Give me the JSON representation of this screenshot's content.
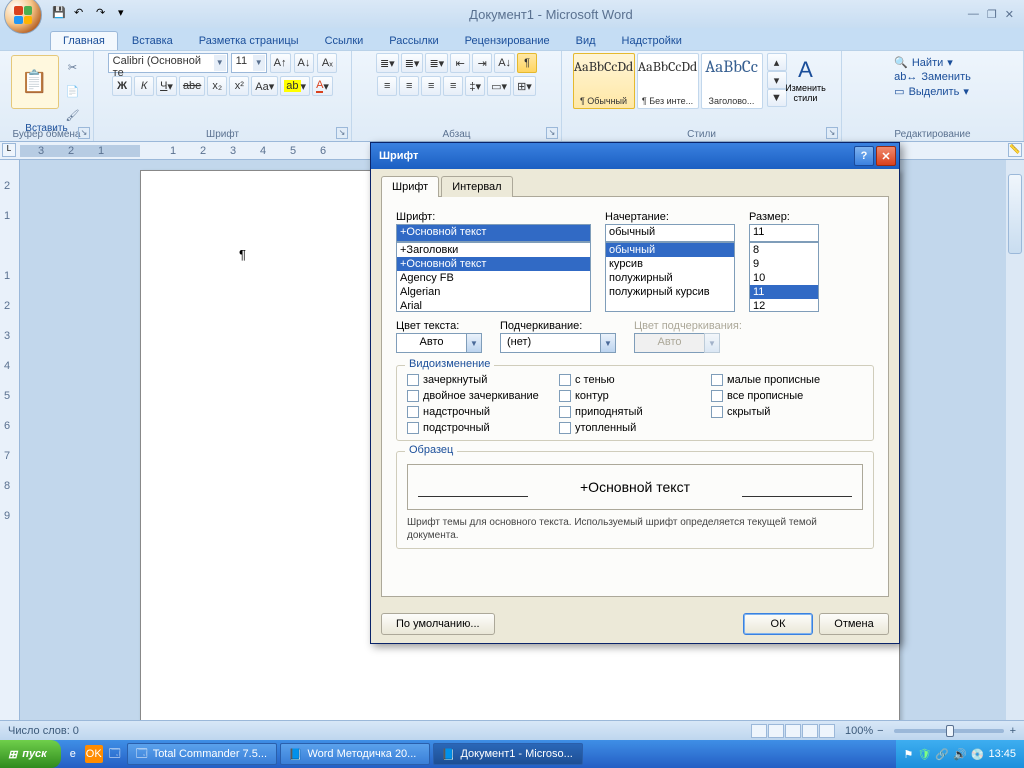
{
  "window": {
    "title": "Документ1 - Microsoft Word"
  },
  "qat": {
    "save": "💾",
    "undo": "↶",
    "redo": "↷"
  },
  "tabs": [
    "Главная",
    "Вставка",
    "Разметка страницы",
    "Ссылки",
    "Рассылки",
    "Рецензирование",
    "Вид",
    "Надстройки"
  ],
  "ribbon": {
    "clipboard": {
      "label": "Буфер обмена",
      "paste": "Вставить"
    },
    "font": {
      "label": "Шрифт",
      "family": "Calibri (Основной те",
      "size": "11"
    },
    "paragraph": {
      "label": "Абзац"
    },
    "styles": {
      "label": "Стили",
      "items": [
        {
          "preview": "AaBbCcDd",
          "name": "¶ Обычный"
        },
        {
          "preview": "AaBbCcDd",
          "name": "¶ Без инте..."
        },
        {
          "preview": "AaBbCc",
          "name": "Заголово..."
        }
      ],
      "change": "Изменить стили"
    },
    "editing": {
      "label": "Редактирование",
      "find": "Найти",
      "replace": "Заменить",
      "select": "Выделить"
    }
  },
  "dialog": {
    "title": "Шрифт",
    "tabs": [
      "Шрифт",
      "Интервал"
    ],
    "font_label": "Шрифт:",
    "font_value": "+Основной текст",
    "font_list": [
      "+Заголовки",
      "+Основной текст",
      "Agency FB",
      "Algerian",
      "Arial"
    ],
    "style_label": "Начертание:",
    "style_value": "обычный",
    "style_list": [
      "обычный",
      "курсив",
      "полужирный",
      "полужирный курсив"
    ],
    "size_label": "Размер:",
    "size_value": "11",
    "size_list": [
      "8",
      "9",
      "10",
      "11",
      "12"
    ],
    "color_label": "Цвет текста:",
    "color_value": "Авто",
    "underline_label": "Подчеркивание:",
    "underline_value": "(нет)",
    "ulcolor_label": "Цвет подчеркивания:",
    "ulcolor_value": "Авто",
    "effects_label": "Видоизменение",
    "effects": [
      "зачеркнутый",
      "с тенью",
      "малые прописные",
      "двойное зачеркивание",
      "контур",
      "все прописные",
      "надстрочный",
      "приподнятый",
      "скрытый",
      "подстрочный",
      "утопленный"
    ],
    "preview_label": "Образец",
    "preview_text": "+Основной текст",
    "desc": "Шрифт темы для основного текста. Используемый шрифт определяется текущей темой документа.",
    "default_btn": "По умолчанию...",
    "ok": "ОК",
    "cancel": "Отмена"
  },
  "status": {
    "words": "Число слов: 0",
    "zoom": "100%"
  },
  "taskbar": {
    "start": "пуск",
    "items": [
      {
        "icon": "🗔",
        "label": "Total Commander 7.5..."
      },
      {
        "icon": "📘",
        "label": "Word Методичка 20..."
      },
      {
        "icon": "📘",
        "label": "Документ1 - Microso..."
      }
    ],
    "time": "13:45"
  }
}
